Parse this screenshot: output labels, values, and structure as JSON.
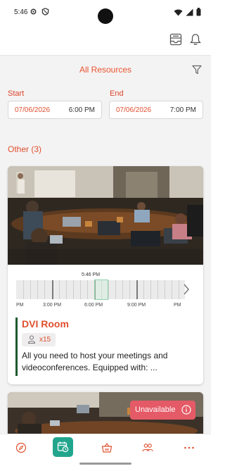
{
  "status_bar": {
    "time": "5:46",
    "left_icons": [
      "settings-icon",
      "shield-icon"
    ],
    "right_icons": [
      "wifi-icon",
      "signal-icon",
      "battery-icon"
    ]
  },
  "header": {
    "icons": [
      "inbox-icon",
      "notification-bell-icon"
    ]
  },
  "filter": {
    "title": "All Resources",
    "icon": "filter-icon"
  },
  "range": {
    "start_label": "Start",
    "start_date": "07/06/2026",
    "start_time": "6:00 PM",
    "end_label": "End",
    "end_date": "07/06/2026",
    "end_time": "7:00 PM"
  },
  "section": {
    "title": "Other (3)"
  },
  "resource": {
    "name": "DVI Room",
    "capacity": "x15",
    "capacity_icon": "person-icon",
    "description": "All you need to host your meetings and videoconferences. Equipped with: ...",
    "availability": {
      "now_label": "5:46 PM",
      "hour_labels": [
        "PM",
        "3:00 PM",
        "6:00 PM",
        "9:00 PM",
        "PM"
      ]
    }
  },
  "second_resource": {
    "badge": "Unavailable",
    "badge_icon": "info-icon"
  },
  "bottom_nav": {
    "items": [
      "compass-icon",
      "calendar-clock-icon",
      "basket-icon",
      "people-icon",
      "more-icon"
    ],
    "active": "calendar-clock-icon"
  },
  "colors": {
    "accent": "#e0502f",
    "active_nav": "#21a68d",
    "unavailable": "#e45a66",
    "resource_bar": "#1e5a2d"
  }
}
